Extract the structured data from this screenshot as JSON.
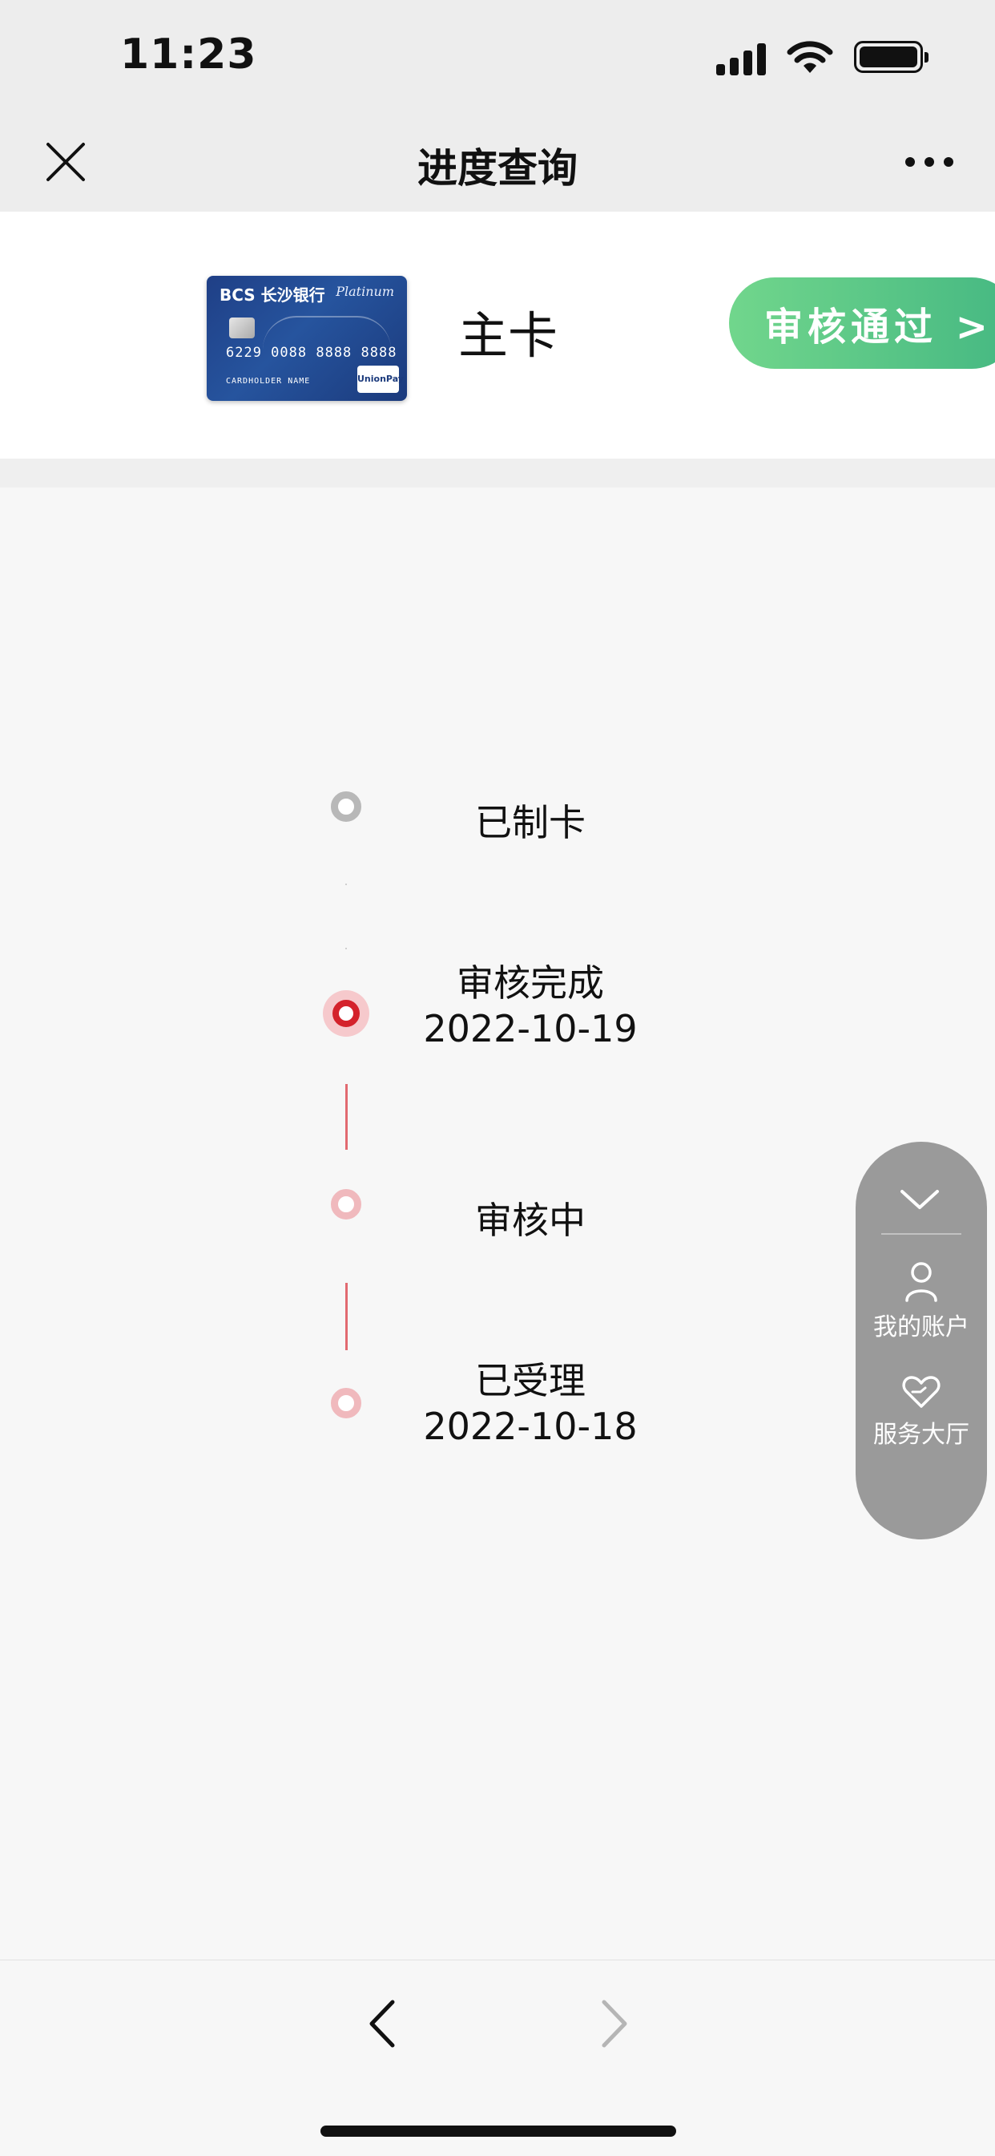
{
  "status_bar": {
    "time": "11:23"
  },
  "nav": {
    "title": "进度查询"
  },
  "card": {
    "bank_logo": "BCS 长沙银行",
    "tier": "Platinum",
    "number": "6229  0088  8888  8888",
    "holder": "CARDHOLDER NAME",
    "network": "UnionPay",
    "type_label": "主卡",
    "status_label": "审核通过 >"
  },
  "timeline": [
    {
      "label": "已制卡",
      "date": "",
      "state": "inactive"
    },
    {
      "label": "审核完成",
      "date": "2022-10-19",
      "state": "current"
    },
    {
      "label": "审核中",
      "date": "",
      "state": "done"
    },
    {
      "label": "已受理",
      "date": "2022-10-18",
      "state": "done"
    }
  ],
  "float_panel": {
    "items": [
      {
        "label": "我的账户",
        "icon": "person-icon"
      },
      {
        "label": "服务大厅",
        "icon": "heart-hand-icon"
      }
    ]
  },
  "toolbar": {
    "back_icon": "chevron-left-icon",
    "forward_icon": "chevron-right-icon"
  },
  "colors": {
    "accent_red": "#d4222b",
    "status_green": "#45b882",
    "inactive_grey": "#b8b8b8"
  }
}
